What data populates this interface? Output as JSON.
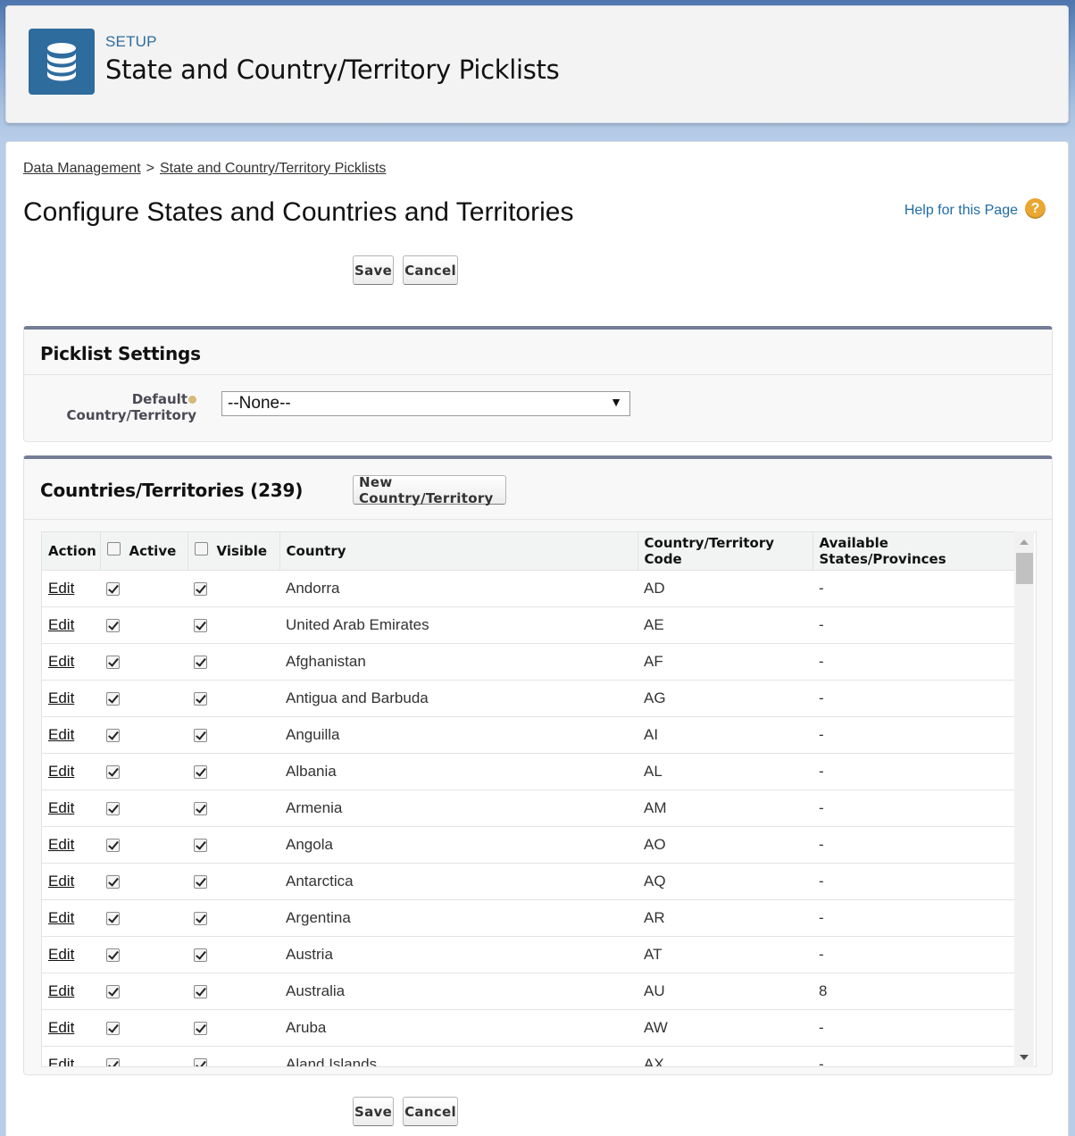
{
  "header": {
    "setup_label": "SETUP",
    "title": "State and Country/Territory Picklists",
    "icon": "database-icon"
  },
  "breadcrumb": {
    "parent": "Data Management",
    "separator": ">",
    "current": "State and Country/Territory Picklists"
  },
  "page": {
    "title": "Configure States and Countries and Territories",
    "help_link": "Help for this Page",
    "help_icon": "?"
  },
  "buttons": {
    "save": "Save",
    "cancel": "Cancel"
  },
  "picklist_settings": {
    "title": "Picklist Settings",
    "default_label_line1": "Default",
    "default_label_line2": "Country/Territory",
    "default_value": "--None--"
  },
  "countries": {
    "title": "Countries/Territories (239)",
    "new_button": "New Country/Territory",
    "columns": {
      "action": "Action",
      "active": "Active",
      "visible": "Visible",
      "country": "Country",
      "code": "Country/Territory Code",
      "states": "Available States/Provinces"
    },
    "rows": [
      {
        "action": "Edit",
        "active": true,
        "visible": true,
        "country": "Andorra",
        "code": "AD",
        "states": "-"
      },
      {
        "action": "Edit",
        "active": true,
        "visible": true,
        "country": "United Arab Emirates",
        "code": "AE",
        "states": "-"
      },
      {
        "action": "Edit",
        "active": true,
        "visible": true,
        "country": "Afghanistan",
        "code": "AF",
        "states": "-"
      },
      {
        "action": "Edit",
        "active": true,
        "visible": true,
        "country": "Antigua and Barbuda",
        "code": "AG",
        "states": "-"
      },
      {
        "action": "Edit",
        "active": true,
        "visible": true,
        "country": "Anguilla",
        "code": "AI",
        "states": "-"
      },
      {
        "action": "Edit",
        "active": true,
        "visible": true,
        "country": "Albania",
        "code": "AL",
        "states": "-"
      },
      {
        "action": "Edit",
        "active": true,
        "visible": true,
        "country": "Armenia",
        "code": "AM",
        "states": "-"
      },
      {
        "action": "Edit",
        "active": true,
        "visible": true,
        "country": "Angola",
        "code": "AO",
        "states": "-"
      },
      {
        "action": "Edit",
        "active": true,
        "visible": true,
        "country": "Antarctica",
        "code": "AQ",
        "states": "-"
      },
      {
        "action": "Edit",
        "active": true,
        "visible": true,
        "country": "Argentina",
        "code": "AR",
        "states": "-"
      },
      {
        "action": "Edit",
        "active": true,
        "visible": true,
        "country": "Austria",
        "code": "AT",
        "states": "-"
      },
      {
        "action": "Edit",
        "active": true,
        "visible": true,
        "country": "Australia",
        "code": "AU",
        "states": "8"
      },
      {
        "action": "Edit",
        "active": true,
        "visible": true,
        "country": "Aruba",
        "code": "AW",
        "states": "-"
      },
      {
        "action": "Edit",
        "active": true,
        "visible": true,
        "country": "Aland Islands",
        "code": "AX",
        "states": "-"
      }
    ]
  }
}
